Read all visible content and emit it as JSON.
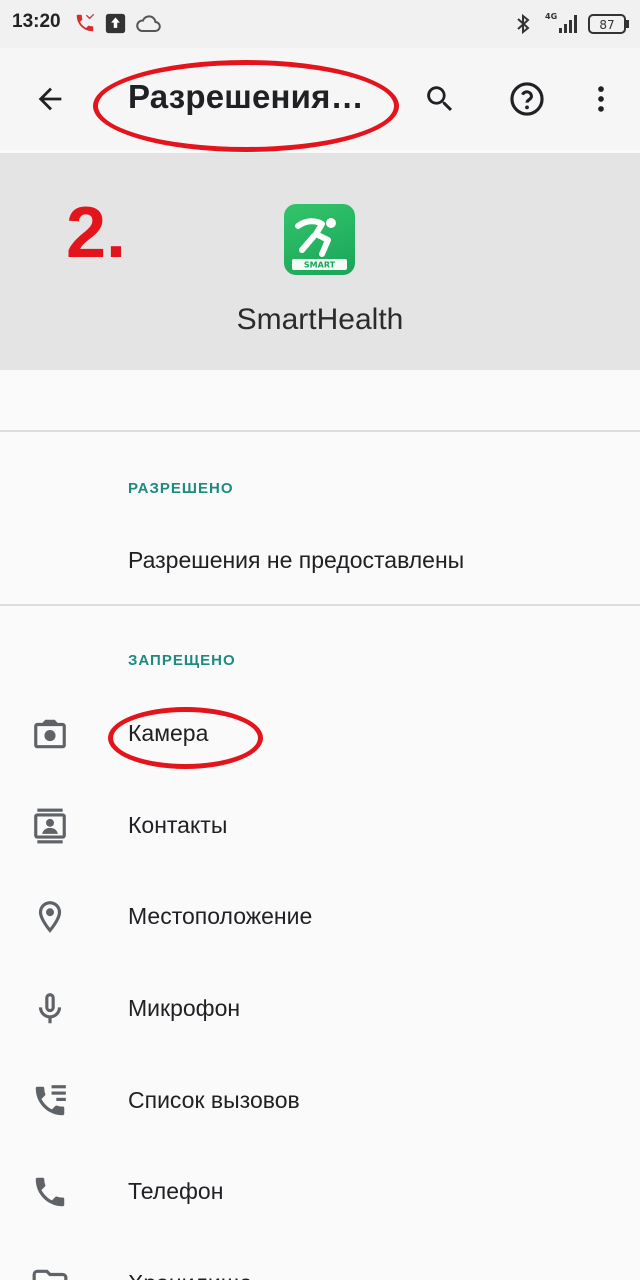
{
  "status_bar": {
    "time": "13:20",
    "network": "4G",
    "battery": "87",
    "icons": [
      "missed-call-icon",
      "upload-notification-icon",
      "cloud-icon",
      "bluetooth-icon",
      "signal-icon",
      "battery-icon"
    ]
  },
  "toolbar": {
    "title": "Разрешения…",
    "icons": [
      "back-arrow-icon",
      "search-icon",
      "help-icon",
      "more-vert-icon"
    ]
  },
  "annotation": {
    "step": "2.",
    "color": "#e3141b"
  },
  "app": {
    "name": "SmartHealth",
    "icon_text": "SMART",
    "icon_color": "#1fb25f"
  },
  "allowed_section": {
    "header": "РАЗРЕШЕНО",
    "empty_text": "Разрешения не предоставлены"
  },
  "denied_section": {
    "header": "ЗАПРЕЩЕНО",
    "items": [
      {
        "label": "Камера",
        "icon": "camera-icon"
      },
      {
        "label": "Контакты",
        "icon": "contacts-icon"
      },
      {
        "label": "Местоположение",
        "icon": "location-icon"
      },
      {
        "label": "Микрофон",
        "icon": "microphone-icon"
      },
      {
        "label": "Список вызовов",
        "icon": "call-log-icon"
      },
      {
        "label": "Телефон",
        "icon": "phone-icon"
      },
      {
        "label": "Хранилище",
        "icon": "folder-icon"
      }
    ]
  },
  "colors": {
    "accent_teal": "#1f8a7f",
    "annotation_red": "#e3141b",
    "header_bg": "#e4e4e4"
  }
}
